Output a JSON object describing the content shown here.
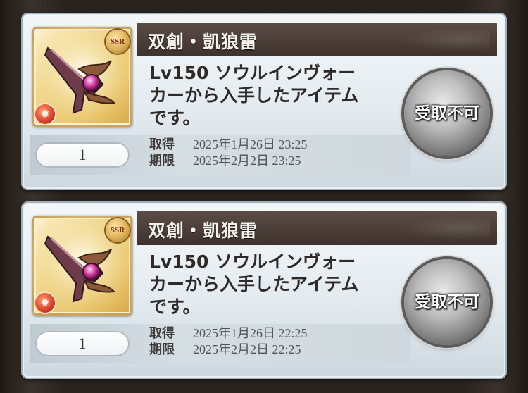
{
  "items": [
    {
      "name": "双創・凱狼雷",
      "description": "Lv150 ソウルインヴォー\nカーから入手したアイテム\nです。",
      "rarity": "SSR",
      "element_icon": "fire-element-icon",
      "quantity": "1",
      "obtained_label": "取得",
      "obtained_date": "2025年1月26日 23:25",
      "expiry_label": "期限",
      "expiry_date": "2025年2月2日 23:25",
      "action_label": "受取不可"
    },
    {
      "name": "双創・凱狼雷",
      "description": "Lv150 ソウルインヴォー\nカーから入手したアイテム\nです。",
      "rarity": "SSR",
      "element_icon": "fire-element-icon",
      "quantity": "1",
      "obtained_label": "取得",
      "obtained_date": "2025年1月26日 22:25",
      "expiry_label": "期限",
      "expiry_date": "2025年2月2日 22:25",
      "action_label": "受取不可"
    }
  ],
  "colors": {
    "title_bar": "#4a3d37",
    "card_bg": "#e3ebf0",
    "button_disabled": "#8a8a8a",
    "icon_frame": "#e7c56a"
  }
}
